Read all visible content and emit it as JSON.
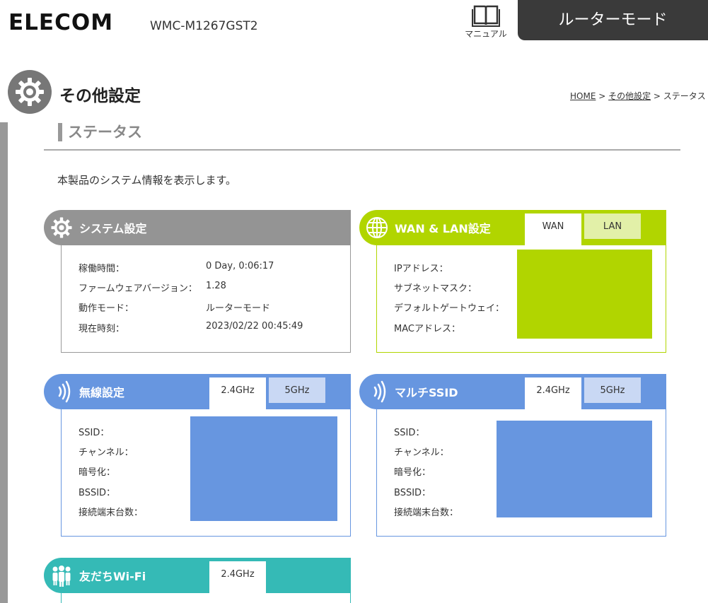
{
  "header": {
    "logo": "ELECOM",
    "model": "WMC-M1267GST2",
    "manual_label": "マニュアル",
    "mode_label": "ルーターモード"
  },
  "page": {
    "title": "その他設定",
    "breadcrumb": {
      "home": "HOME",
      "sep1": " > ",
      "parent": "その他設定",
      "sep2": " > ",
      "current": "ステータス"
    },
    "section_title": "ステータス",
    "description": "本製品のシステム情報を表示します。"
  },
  "system_panel": {
    "title": "システム設定",
    "rows": [
      {
        "label": "稼働時間：",
        "value": "0 Day, 0:06:17"
      },
      {
        "label": "ファームウェアバージョン：",
        "value": "1.28"
      },
      {
        "label": "動作モード：",
        "value": "ルーターモード"
      },
      {
        "label": "現在時刻：",
        "value": "2023/02/22 00:45:49"
      }
    ]
  },
  "wan_panel": {
    "title": "WAN & LAN設定",
    "tabs": [
      "WAN",
      "LAN"
    ],
    "rows": [
      "IPアドレス：",
      "サブネットマスク：",
      "デフォルトゲートウェイ：",
      "MACアドレス："
    ]
  },
  "wireless_panel": {
    "title": "無線設定",
    "tabs": [
      "2.4GHz",
      "5GHz"
    ],
    "rows": [
      "SSID：",
      "チャンネル：",
      "暗号化：",
      "BSSID：",
      "接続端末台数："
    ]
  },
  "multi_panel": {
    "title": "マルチSSID",
    "tabs": [
      "2.4GHz",
      "5GHz"
    ],
    "rows": [
      "SSID：",
      "チャンネル：",
      "暗号化：",
      "BSSID：",
      "接続端末台数："
    ]
  },
  "friend_panel": {
    "title": "友だちWi-Fi",
    "tabs": [
      "2.4GHz"
    ]
  },
  "colors": {
    "gray": "#949494",
    "green": "#b1d500",
    "green_tab": "#e2f0a8",
    "blue": "#6796e0",
    "blue_tab": "#c9d8f4",
    "teal": "#35bab6",
    "dark": "#3a3a3a"
  }
}
